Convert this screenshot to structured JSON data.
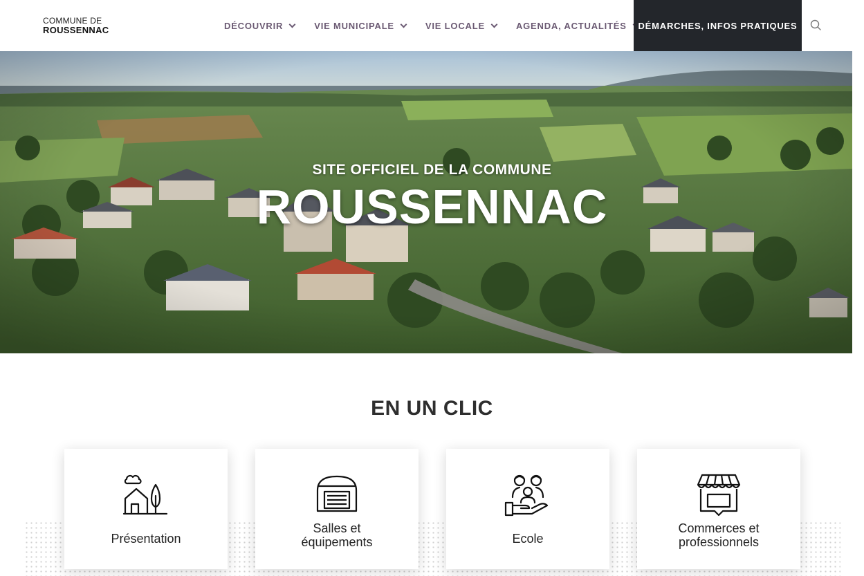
{
  "header": {
    "logo_line1": "COMMUNE DE",
    "logo_line2": "ROUSSENNAC",
    "nav": [
      {
        "label": "DÉCOUVRIR"
      },
      {
        "label": "VIE MUNICIPALE"
      },
      {
        "label": "VIE LOCALE"
      },
      {
        "label": "AGENDA, ACTUALITÉS"
      }
    ],
    "active_label": "DÉMARCHES, INFOS PRATIQUES",
    "search_icon": "search-icon"
  },
  "hero": {
    "subtitle": "SITE OFFICIEL DE LA COMMUNE",
    "title": "ROUSSENNAC"
  },
  "section": {
    "title": "EN UN CLIC",
    "cards": [
      {
        "label": "Présentation",
        "icon": "village-icon"
      },
      {
        "label_line1": "Salles et",
        "label_line2": "équipements",
        "icon": "hall-icon"
      },
      {
        "label": "Ecole",
        "icon": "school-icon"
      },
      {
        "label_line1": "Commerces et",
        "label_line2": "professionnels",
        "icon": "shop-icon"
      }
    ]
  },
  "colors": {
    "nav_text": "#6b5a73",
    "nav_active_bg": "#23262b",
    "title_text": "#2e2e2e"
  }
}
